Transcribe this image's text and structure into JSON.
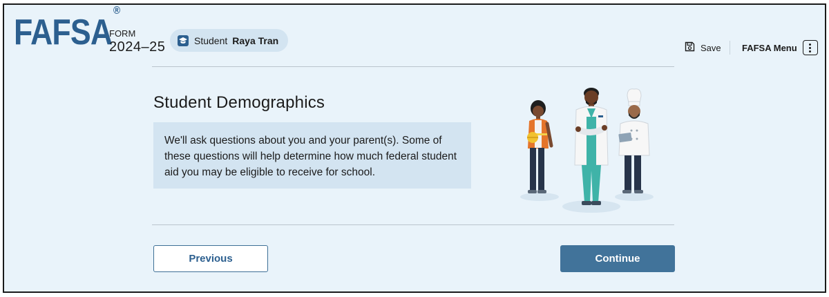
{
  "header": {
    "logo_text": "FAFSA",
    "logo_mark": "®",
    "form_label": "FORM",
    "form_year": "2024–25",
    "student_role": "Student",
    "student_name": "Raya Tran",
    "save_label": "Save",
    "menu_label": "FAFSA Menu"
  },
  "main": {
    "title": "Student Demographics",
    "description": "We'll ask questions about you and your parent(s). Some of these questions will help determine how much federal student aid you may be eligible to receive for school."
  },
  "footer": {
    "previous_label": "Previous",
    "continue_label": "Continue"
  },
  "icons": {
    "student": "graduation-cap-icon",
    "save": "floppy-disk-icon",
    "menu": "kebab-menu-icon"
  },
  "colors": {
    "brand_blue": "#2c5f8f",
    "button_primary": "#41739a",
    "page_background": "#e9f3fa",
    "info_background": "#d3e4f1"
  }
}
